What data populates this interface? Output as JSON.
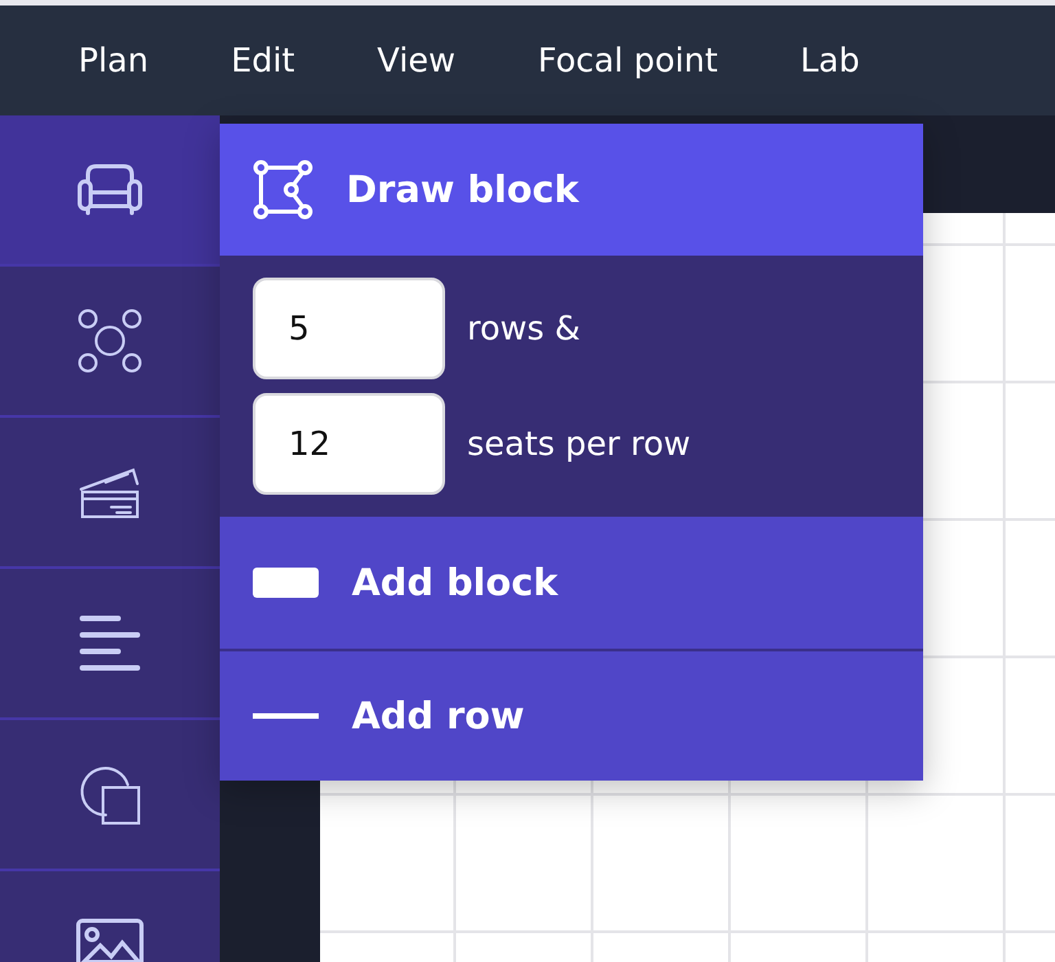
{
  "menu_bar": {
    "items": [
      {
        "label": "Plan"
      },
      {
        "label": "Edit"
      },
      {
        "label": "View"
      },
      {
        "label": "Focal point"
      },
      {
        "label": "Lab"
      }
    ]
  },
  "sidebar": {
    "items": [
      {
        "kind": "sofa",
        "selected": true
      },
      {
        "kind": "nodes",
        "selected": false
      },
      {
        "kind": "tickets",
        "selected": false
      },
      {
        "kind": "text",
        "selected": false
      },
      {
        "kind": "shapes",
        "selected": false
      },
      {
        "kind": "image",
        "selected": false
      }
    ]
  },
  "popup": {
    "title": "Draw block",
    "fields": [
      {
        "value": "5",
        "label": "rows &"
      },
      {
        "value": "12",
        "label": "seats per row"
      }
    ],
    "actions": [
      {
        "kind": "block",
        "label": "Add block"
      },
      {
        "kind": "row",
        "label": "Add row"
      }
    ]
  }
}
